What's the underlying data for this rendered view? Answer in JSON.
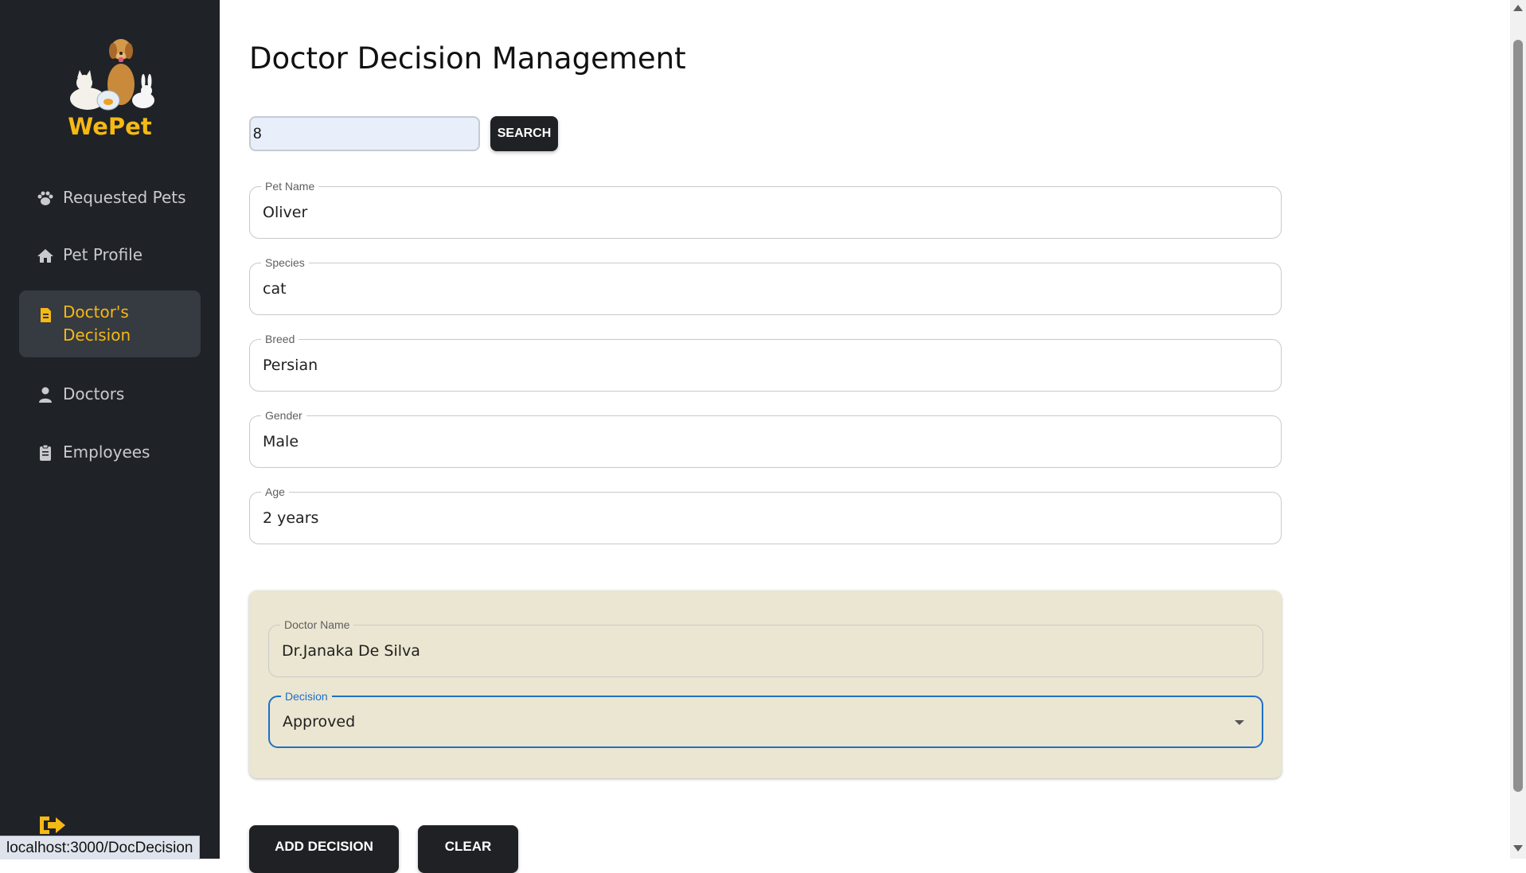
{
  "brand": {
    "name": "WePet",
    "accent": "#f5b914"
  },
  "sidebar": {
    "items": [
      {
        "label": "Requested Pets",
        "icon": "paw-icon"
      },
      {
        "label": "Pet Profile",
        "icon": "home-icon"
      },
      {
        "label": "Doctor's Decision",
        "icon": "document-icon",
        "active": true
      },
      {
        "label": "Doctors",
        "icon": "doctor-icon"
      },
      {
        "label": "Employees",
        "icon": "clipboard-icon"
      }
    ],
    "logout_icon": "logout-icon"
  },
  "main": {
    "title": "Doctor Decision Management",
    "search": {
      "value": "8",
      "button_label": "SEARCH"
    },
    "fields": [
      {
        "label": "Pet Name",
        "value": "Oliver"
      },
      {
        "label": "Species",
        "value": "cat"
      },
      {
        "label": "Breed",
        "value": "Persian"
      },
      {
        "label": "Gender",
        "value": "Male"
      },
      {
        "label": "Age",
        "value": "2 years"
      }
    ],
    "decision_panel": {
      "doctor_name_label": "Doctor Name",
      "doctor_name_value": "Dr.Janaka De Silva",
      "decision_label": "Decision",
      "decision_value": "Approved"
    },
    "buttons": {
      "add": "ADD DECISION",
      "clear": "CLEAR"
    }
  },
  "status_bar": {
    "url": "localhost:3000/DocDecision"
  }
}
